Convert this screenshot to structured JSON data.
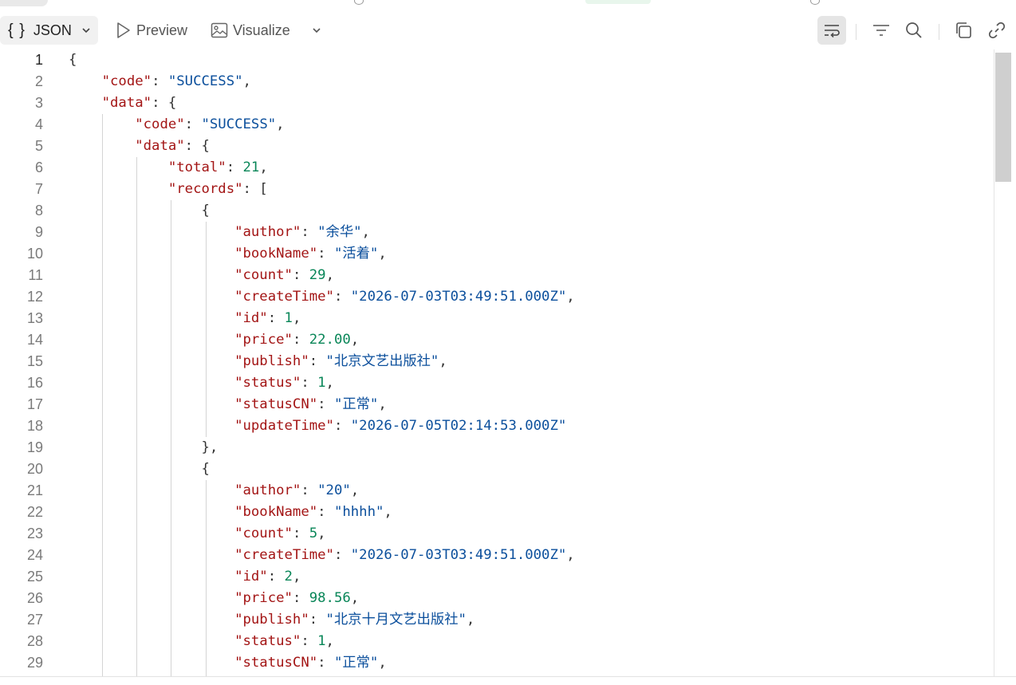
{
  "toolbar": {
    "mode_label": "JSON",
    "mode_icon": "braces-icon",
    "preview_label": "Preview",
    "visualize_label": "Visualize",
    "right_icons": [
      "wrap-lines-icon",
      "filter-icon",
      "search-icon",
      "copy-icon",
      "link-icon"
    ]
  },
  "editor": {
    "line_numbers": [
      "1",
      "2",
      "3",
      "4",
      "5",
      "6",
      "7",
      "8",
      "9",
      "10",
      "11",
      "12",
      "13",
      "14",
      "15",
      "16",
      "17",
      "18",
      "19",
      "20",
      "21",
      "22",
      "23",
      "24",
      "25",
      "26",
      "27",
      "28",
      "29"
    ],
    "lines": [
      [
        {
          "t": "p",
          "v": "{"
        }
      ],
      [
        {
          "t": "p",
          "v": "    "
        },
        {
          "t": "k",
          "v": "\"code\""
        },
        {
          "t": "p",
          "v": ": "
        },
        {
          "t": "s",
          "v": "\"SUCCESS\""
        },
        {
          "t": "p",
          "v": ","
        }
      ],
      [
        {
          "t": "p",
          "v": "    "
        },
        {
          "t": "k",
          "v": "\"data\""
        },
        {
          "t": "p",
          "v": ": {"
        }
      ],
      [
        {
          "t": "p",
          "v": "        "
        },
        {
          "t": "k",
          "v": "\"code\""
        },
        {
          "t": "p",
          "v": ": "
        },
        {
          "t": "s",
          "v": "\"SUCCESS\""
        },
        {
          "t": "p",
          "v": ","
        }
      ],
      [
        {
          "t": "p",
          "v": "        "
        },
        {
          "t": "k",
          "v": "\"data\""
        },
        {
          "t": "p",
          "v": ": {"
        }
      ],
      [
        {
          "t": "p",
          "v": "            "
        },
        {
          "t": "k",
          "v": "\"total\""
        },
        {
          "t": "p",
          "v": ": "
        },
        {
          "t": "n",
          "v": "21"
        },
        {
          "t": "p",
          "v": ","
        }
      ],
      [
        {
          "t": "p",
          "v": "            "
        },
        {
          "t": "k",
          "v": "\"records\""
        },
        {
          "t": "p",
          "v": ": ["
        }
      ],
      [
        {
          "t": "p",
          "v": "                {"
        }
      ],
      [
        {
          "t": "p",
          "v": "                    "
        },
        {
          "t": "k",
          "v": "\"author\""
        },
        {
          "t": "p",
          "v": ": "
        },
        {
          "t": "s",
          "v": "\"余华\""
        },
        {
          "t": "p",
          "v": ","
        }
      ],
      [
        {
          "t": "p",
          "v": "                    "
        },
        {
          "t": "k",
          "v": "\"bookName\""
        },
        {
          "t": "p",
          "v": ": "
        },
        {
          "t": "s",
          "v": "\"活着\""
        },
        {
          "t": "p",
          "v": ","
        }
      ],
      [
        {
          "t": "p",
          "v": "                    "
        },
        {
          "t": "k",
          "v": "\"count\""
        },
        {
          "t": "p",
          "v": ": "
        },
        {
          "t": "n",
          "v": "29"
        },
        {
          "t": "p",
          "v": ","
        }
      ],
      [
        {
          "t": "p",
          "v": "                    "
        },
        {
          "t": "k",
          "v": "\"createTime\""
        },
        {
          "t": "p",
          "v": ": "
        },
        {
          "t": "s",
          "v": "\"2026-07-03T03:49:51.000Z\""
        },
        {
          "t": "p",
          "v": ","
        }
      ],
      [
        {
          "t": "p",
          "v": "                    "
        },
        {
          "t": "k",
          "v": "\"id\""
        },
        {
          "t": "p",
          "v": ": "
        },
        {
          "t": "n",
          "v": "1"
        },
        {
          "t": "p",
          "v": ","
        }
      ],
      [
        {
          "t": "p",
          "v": "                    "
        },
        {
          "t": "k",
          "v": "\"price\""
        },
        {
          "t": "p",
          "v": ": "
        },
        {
          "t": "n",
          "v": "22.00"
        },
        {
          "t": "p",
          "v": ","
        }
      ],
      [
        {
          "t": "p",
          "v": "                    "
        },
        {
          "t": "k",
          "v": "\"publish\""
        },
        {
          "t": "p",
          "v": ": "
        },
        {
          "t": "s",
          "v": "\"北京文艺出版社\""
        },
        {
          "t": "p",
          "v": ","
        }
      ],
      [
        {
          "t": "p",
          "v": "                    "
        },
        {
          "t": "k",
          "v": "\"status\""
        },
        {
          "t": "p",
          "v": ": "
        },
        {
          "t": "n",
          "v": "1"
        },
        {
          "t": "p",
          "v": ","
        }
      ],
      [
        {
          "t": "p",
          "v": "                    "
        },
        {
          "t": "k",
          "v": "\"statusCN\""
        },
        {
          "t": "p",
          "v": ": "
        },
        {
          "t": "s",
          "v": "\"正常\""
        },
        {
          "t": "p",
          "v": ","
        }
      ],
      [
        {
          "t": "p",
          "v": "                    "
        },
        {
          "t": "k",
          "v": "\"updateTime\""
        },
        {
          "t": "p",
          "v": ": "
        },
        {
          "t": "s",
          "v": "\"2026-07-05T02:14:53.000Z\""
        }
      ],
      [
        {
          "t": "p",
          "v": "                },"
        }
      ],
      [
        {
          "t": "p",
          "v": "                {"
        }
      ],
      [
        {
          "t": "p",
          "v": "                    "
        },
        {
          "t": "k",
          "v": "\"author\""
        },
        {
          "t": "p",
          "v": ": "
        },
        {
          "t": "s",
          "v": "\"20\""
        },
        {
          "t": "p",
          "v": ","
        }
      ],
      [
        {
          "t": "p",
          "v": "                    "
        },
        {
          "t": "k",
          "v": "\"bookName\""
        },
        {
          "t": "p",
          "v": ": "
        },
        {
          "t": "s",
          "v": "\"hhhh\""
        },
        {
          "t": "p",
          "v": ","
        }
      ],
      [
        {
          "t": "p",
          "v": "                    "
        },
        {
          "t": "k",
          "v": "\"count\""
        },
        {
          "t": "p",
          "v": ": "
        },
        {
          "t": "n",
          "v": "5"
        },
        {
          "t": "p",
          "v": ","
        }
      ],
      [
        {
          "t": "p",
          "v": "                    "
        },
        {
          "t": "k",
          "v": "\"createTime\""
        },
        {
          "t": "p",
          "v": ": "
        },
        {
          "t": "s",
          "v": "\"2026-07-03T03:49:51.000Z\""
        },
        {
          "t": "p",
          "v": ","
        }
      ],
      [
        {
          "t": "p",
          "v": "                    "
        },
        {
          "t": "k",
          "v": "\"id\""
        },
        {
          "t": "p",
          "v": ": "
        },
        {
          "t": "n",
          "v": "2"
        },
        {
          "t": "p",
          "v": ","
        }
      ],
      [
        {
          "t": "p",
          "v": "                    "
        },
        {
          "t": "k",
          "v": "\"price\""
        },
        {
          "t": "p",
          "v": ": "
        },
        {
          "t": "n",
          "v": "98.56"
        },
        {
          "t": "p",
          "v": ","
        }
      ],
      [
        {
          "t": "p",
          "v": "                    "
        },
        {
          "t": "k",
          "v": "\"publish\""
        },
        {
          "t": "p",
          "v": ": "
        },
        {
          "t": "s",
          "v": "\"北京十月文艺出版社\""
        },
        {
          "t": "p",
          "v": ","
        }
      ],
      [
        {
          "t": "p",
          "v": "                    "
        },
        {
          "t": "k",
          "v": "\"status\""
        },
        {
          "t": "p",
          "v": ": "
        },
        {
          "t": "n",
          "v": "1"
        },
        {
          "t": "p",
          "v": ","
        }
      ],
      [
        {
          "t": "p",
          "v": "                    "
        },
        {
          "t": "k",
          "v": "\"statusCN\""
        },
        {
          "t": "p",
          "v": ": "
        },
        {
          "t": "s",
          "v": "\"正常\""
        },
        {
          "t": "p",
          "v": ","
        }
      ]
    ]
  },
  "colors": {
    "key": "#a31515",
    "string": "#0b4f9c",
    "number": "#098658",
    "punctuation": "#333333"
  }
}
